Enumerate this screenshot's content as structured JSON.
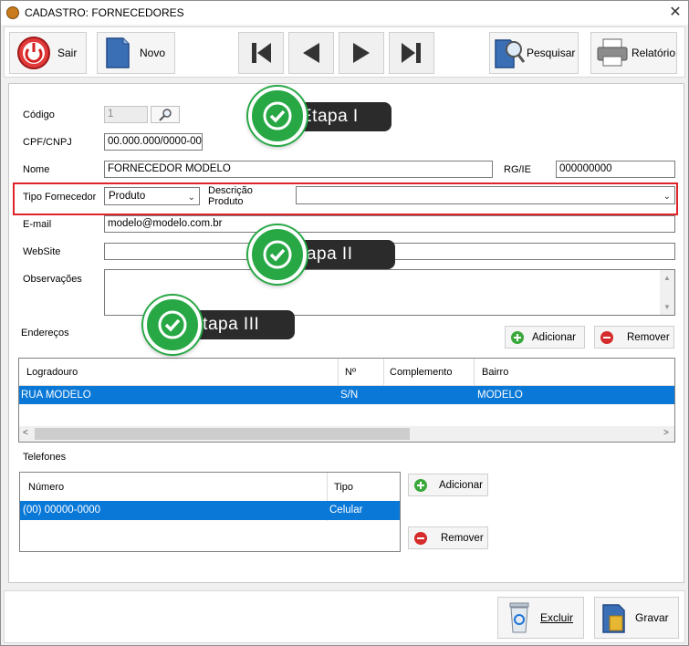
{
  "window": {
    "title": "CADASTRO: FORNECEDORES",
    "close_glyph": "✕"
  },
  "toolbar": {
    "sair": "Sair",
    "novo": "Novo",
    "pesquisar": "Pesquisar",
    "relatorio": "Relatório"
  },
  "form": {
    "codigo_label": "Código",
    "codigo_value": "1",
    "cpf_label": "CPF/CNPJ",
    "cpf_value": "00.000.000/0000-00",
    "nome_label": "Nome",
    "nome_value": "FORNECEDOR MODELO",
    "rg_label": "RG/IE",
    "rg_value": "000000000",
    "tipo_label": "Tipo Fornecedor",
    "tipo_value": "Produto",
    "descricao_label_1": "Descrição",
    "descricao_label_2": "Produto",
    "descricao_value": "",
    "email_label": "E-mail",
    "email_value": "modelo@modelo.com.br",
    "website_label": "WebSite",
    "website_value": "",
    "obs_label": "Observações",
    "obs_value": ""
  },
  "enderecos": {
    "label": "Endereços",
    "add": "Adicionar",
    "remove": "Remover",
    "columns": [
      "Logradouro",
      "Nº",
      "Complemento",
      "Bairro"
    ],
    "rows": [
      {
        "logradouro": "RUA MODELO",
        "numero": "S/N",
        "complemento": "",
        "bairro": "MODELO"
      }
    ]
  },
  "telefones": {
    "label": "Telefones",
    "add": "Adicionar",
    "remove": "Remover",
    "columns": [
      "Número",
      "Tipo"
    ],
    "rows": [
      {
        "numero": "(00) 00000-0000",
        "tipo": "Celular"
      }
    ]
  },
  "footer": {
    "excluir": "Excluir",
    "gravar": "Gravar"
  },
  "annotations": {
    "etapa1": "Etapa I",
    "etapa2": "Etapa II",
    "etapa3": "Etapa III"
  },
  "colors": {
    "accent_red": "#e0232b",
    "selection": "#0a78d7",
    "badge_green": "#27a845"
  }
}
